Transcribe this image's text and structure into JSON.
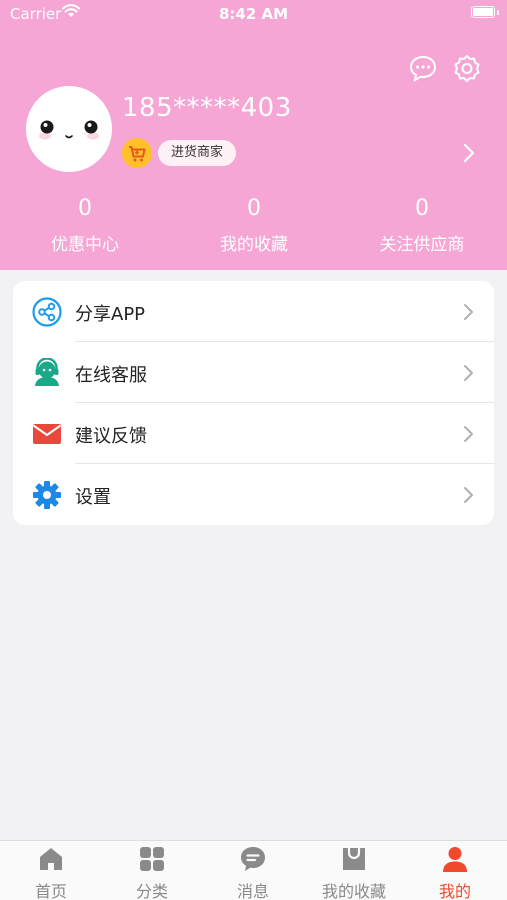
{
  "status_bar": {
    "carrier": "Carrier",
    "time": "8:42 AM"
  },
  "profile": {
    "phone": "185*****403",
    "role_tag": "进货商家"
  },
  "stats": [
    {
      "value": "0",
      "label": "优惠中心"
    },
    {
      "value": "0",
      "label": "我的收藏"
    },
    {
      "value": "0",
      "label": "关注供应商"
    }
  ],
  "menu": [
    {
      "label": "分享APP",
      "icon": "share-icon",
      "color": "#1e9be8"
    },
    {
      "label": "在线客服",
      "icon": "customer-service-icon",
      "color": "#1aa88a"
    },
    {
      "label": "建议反馈",
      "icon": "mail-icon",
      "color": "#e8493c"
    },
    {
      "label": "设置",
      "icon": "settings-gear-icon",
      "color": "#1e88e5"
    }
  ],
  "tabbar": {
    "items": [
      {
        "label": "首页",
        "icon": "home-icon"
      },
      {
        "label": "分类",
        "icon": "category-icon"
      },
      {
        "label": "消息",
        "icon": "message-icon"
      },
      {
        "label": "我的收藏",
        "icon": "favorites-bag-icon"
      },
      {
        "label": "我的",
        "icon": "profile-icon",
        "active": true
      }
    ],
    "active_color": "#f04a2e",
    "inactive_color": "#8a8a8a"
  },
  "colors": {
    "header_bg": "#f5a6d5",
    "page_bg": "#f2f2f4"
  }
}
